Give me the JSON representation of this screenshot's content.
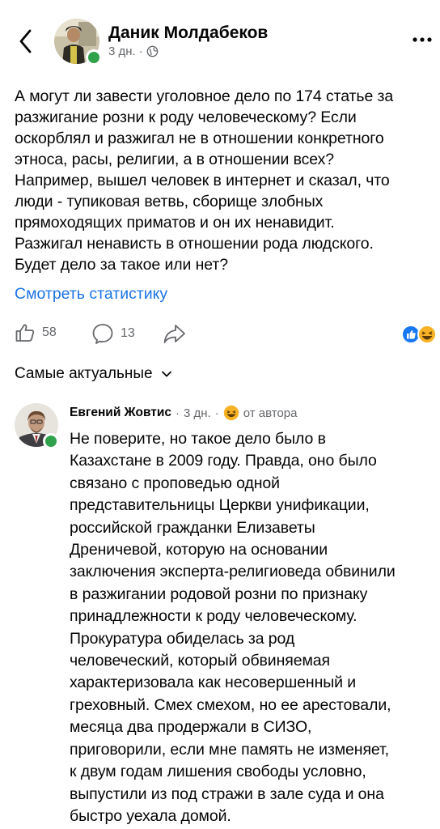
{
  "post": {
    "author": "Даник Молдабеков",
    "time": "3 дн.",
    "separator": "·",
    "text": "А могут ли завести уголовное дело по 174 статье за\nразжигание розни к роду человеческому? Если\nоскорблял и разжигал не в отношении конкретного\nэтноса, расы, религии, а в отношении всех?\nНапример, вышел человек в интернет и сказал, что\nлюди - тупиковая ветвь, сборище злобных\nпрямоходящих приматов и он их ненавидит.\nРазжигал ненависть в отношении рода людского.\nБудет дело за такое или нет?",
    "stats_link": "Смотреть статистику",
    "likes": "58",
    "comments": "13"
  },
  "sort": {
    "label": "Самые актуальные"
  },
  "comment": {
    "author": "Евгений Жовтис",
    "time": "3 дн.",
    "separator": "·",
    "badge": "от автора",
    "text": "Не поверите, но такое дело было в\nКазахстане в 2009 году. Правда, оно было\nсвязано с проповедью одной\nпредставительницы Церкви унификации,\nроссийской гражданки Елизаветы\nДреничевой, которую на основании\nзаключения эксперта-религиоведа обвинили\nв разжигании родовой розни по признаку\nпринадлежности к роду человеческому.\nПрокуратура обиделась за род\nчеловеческий, который обвиняемая\nхарактеризовала как несовершенный и\nгреховный. Смех смехом, но ее арестовали,\nмесяца два продержали в СИЗО,\nприговорили, если мне память не изменяет,\nк двум годам лишения свободы условно,\nвыпустили из под стражи в зале суда и она\nбыстро уехала домой."
  },
  "icons": {
    "back": "chevron-left-icon",
    "more": "more-dots-icon",
    "privacy": "globe-icon",
    "like": "thumbs-up-icon",
    "comment": "comment-bubble-icon",
    "share": "share-arrow-icon",
    "sort": "chevron-down-icon",
    "reaction_like": "like-reaction-icon",
    "reaction_haha": "haha-reaction-icon"
  },
  "colors": {
    "link": "#1b74e4",
    "online": "#31a24c",
    "like_reaction": "#1877f2",
    "haha_reaction": "#f7b125",
    "secondary_text": "#65676b"
  }
}
